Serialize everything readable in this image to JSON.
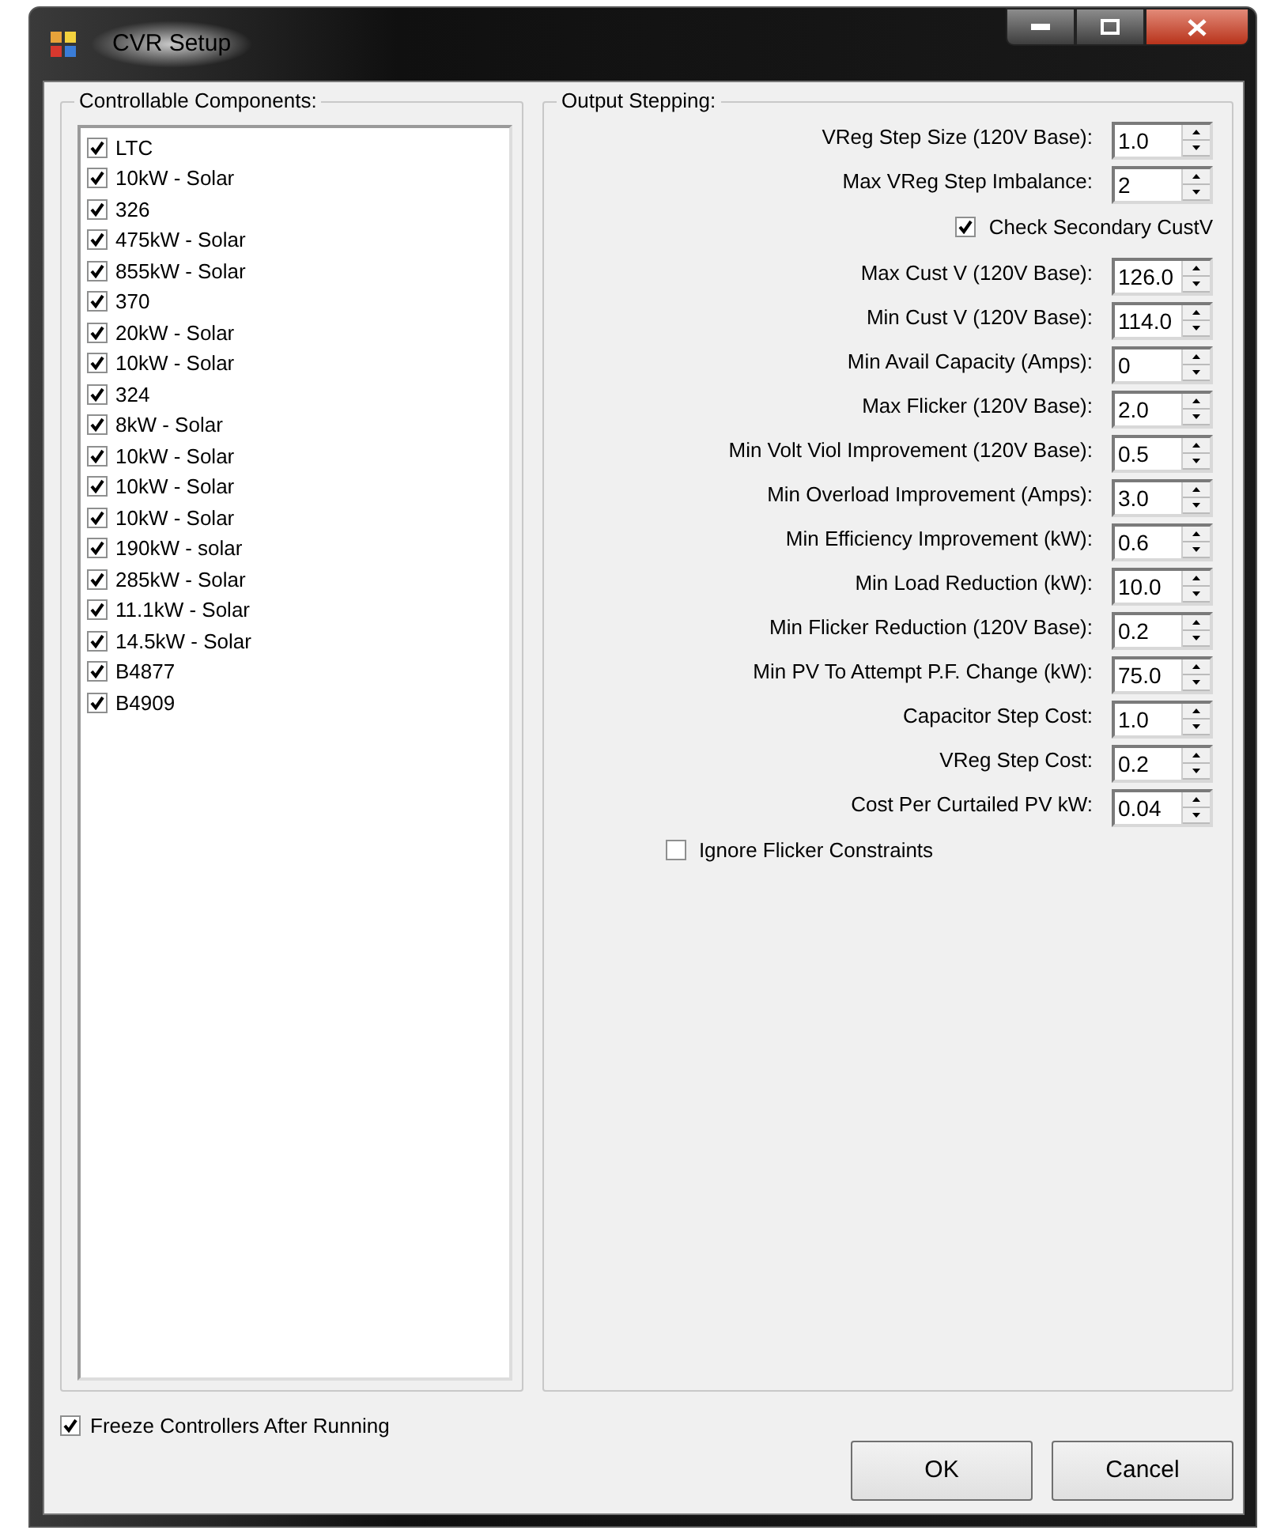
{
  "window": {
    "title": "CVR Setup"
  },
  "components": {
    "title": "Controllable Components:",
    "items": [
      {
        "label": "LTC",
        "checked": true
      },
      {
        "label": "10kW - Solar",
        "checked": true
      },
      {
        "label": "326",
        "checked": true
      },
      {
        "label": "475kW - Solar",
        "checked": true
      },
      {
        "label": "855kW - Solar",
        "checked": true
      },
      {
        "label": "370",
        "checked": true
      },
      {
        "label": "20kW - Solar",
        "checked": true
      },
      {
        "label": "10kW - Solar",
        "checked": true
      },
      {
        "label": "324",
        "checked": true
      },
      {
        "label": "8kW - Solar",
        "checked": true
      },
      {
        "label": "10kW - Solar",
        "checked": true
      },
      {
        "label": "10kW - Solar",
        "checked": true
      },
      {
        "label": "10kW - Solar",
        "checked": true
      },
      {
        "label": "190kW - solar",
        "checked": true
      },
      {
        "label": "285kW - Solar",
        "checked": true
      },
      {
        "label": "11.1kW - Solar",
        "checked": true
      },
      {
        "label": "14.5kW - Solar",
        "checked": true
      },
      {
        "label": "B4877",
        "checked": true
      },
      {
        "label": "B4909",
        "checked": true
      }
    ]
  },
  "output_stepping": {
    "title": "Output Stepping:",
    "rows": [
      {
        "kind": "spinner",
        "label": "VReg Step Size (120V Base):",
        "value": "1.0"
      },
      {
        "kind": "spinner",
        "label": "Max VReg Step Imbalance:",
        "value": "2"
      },
      {
        "kind": "checkbox",
        "label": "Check Secondary CustV",
        "checked": true
      },
      {
        "kind": "spinner",
        "label": "Max Cust V (120V Base):",
        "value": "126.0"
      },
      {
        "kind": "spinner",
        "label": "Min Cust V (120V Base):",
        "value": "114.0"
      },
      {
        "kind": "spinner",
        "label": "Min Avail Capacity (Amps):",
        "value": "0"
      },
      {
        "kind": "spinner",
        "label": "Max Flicker (120V Base):",
        "value": "2.0"
      },
      {
        "kind": "spinner",
        "label": "Min Volt Viol Improvement (120V Base):",
        "value": "0.5"
      },
      {
        "kind": "spinner",
        "label": "Min Overload Improvement (Amps):",
        "value": "3.0"
      },
      {
        "kind": "spinner",
        "label": "Min Efficiency Improvement (kW):",
        "value": "0.6"
      },
      {
        "kind": "spinner",
        "label": "Min Load Reduction (kW):",
        "value": "10.0"
      },
      {
        "kind": "spinner",
        "label": "Min Flicker Reduction (120V Base):",
        "value": "0.2"
      },
      {
        "kind": "spinner",
        "label": "Min PV To Attempt P.F. Change (kW):",
        "value": "75.0"
      },
      {
        "kind": "spinner",
        "label": "Capacitor Step Cost:",
        "value": "1.0"
      },
      {
        "kind": "spinner",
        "label": "VReg Step Cost:",
        "value": "0.2"
      },
      {
        "kind": "spinner",
        "label": "Cost Per Curtailed PV kW:",
        "value": "0.04"
      },
      {
        "kind": "checkbox",
        "label": "Ignore Flicker Constraints",
        "checked": false
      }
    ]
  },
  "freeze": {
    "label": "Freeze Controllers After Running",
    "checked": true
  },
  "buttons": [
    "OK",
    "Cancel"
  ]
}
